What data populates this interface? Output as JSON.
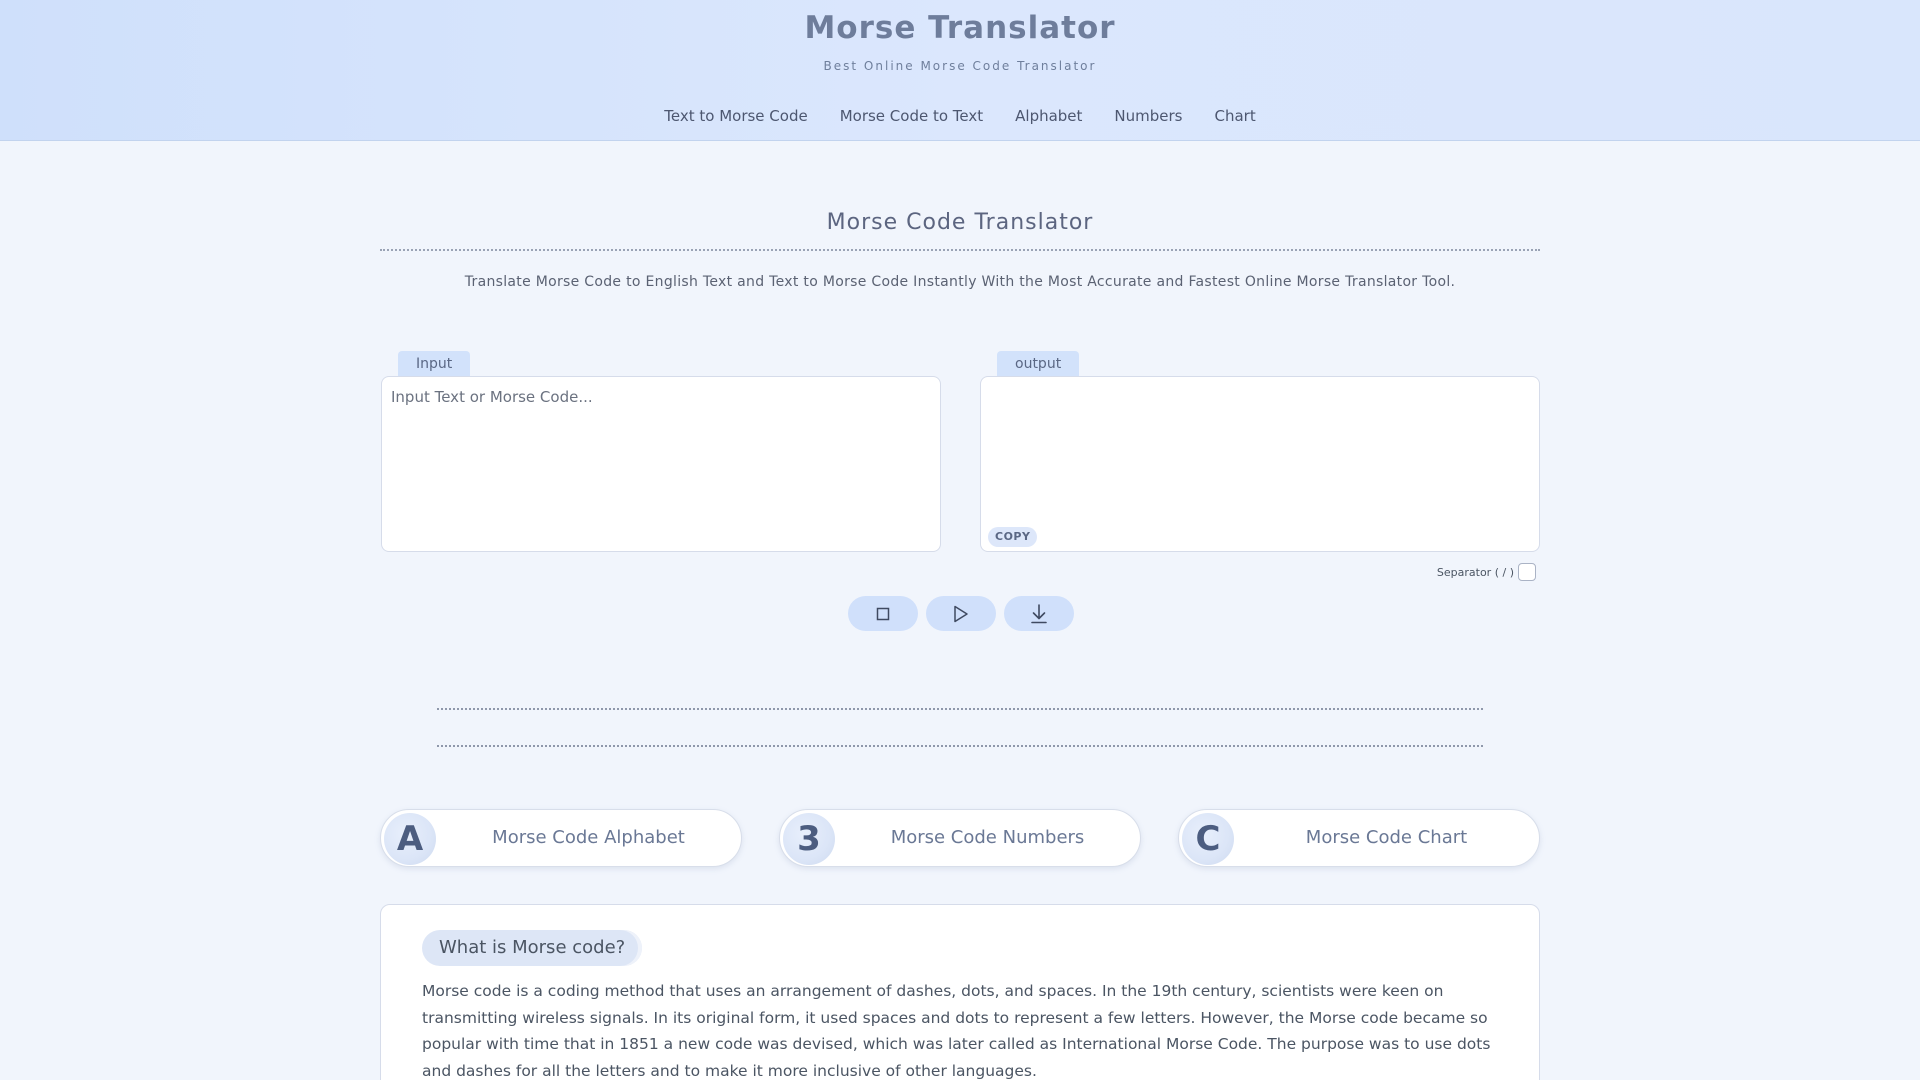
{
  "header": {
    "title": "Morse Translator",
    "subtitle": "Best Online Morse Code Translator",
    "nav": [
      "Text to Morse Code",
      "Morse Code to Text",
      "Alphabet",
      "Numbers",
      "Chart"
    ]
  },
  "main": {
    "title": "Morse Code Translator",
    "description": "Translate Morse Code to English Text and Text to Morse Code Instantly With the Most Accurate and Fastest Online Morse Translator Tool."
  },
  "input_panel": {
    "tab_label": "Input",
    "placeholder": "Input Text or Morse Code...",
    "value": ""
  },
  "output_panel": {
    "tab_label": "output",
    "value": "",
    "copy_label": "COPY"
  },
  "separator": {
    "label": "Separator ( / )",
    "checked": false
  },
  "controls": {
    "icons": [
      "stop-icon",
      "play-icon",
      "download-icon"
    ]
  },
  "cards": [
    {
      "badge": "A",
      "label": "Morse Code Alphabet",
      "icon": "letter-a-icon"
    },
    {
      "badge": "3",
      "label": "Morse Code Numbers",
      "icon": "number-3-icon"
    },
    {
      "badge": "C",
      "label": "Morse Code Chart",
      "icon": "chart-c-icon"
    }
  ],
  "info": {
    "heading": "What is Morse code?",
    "text": "Morse code is a coding method that uses an arrangement of dashes, dots, and spaces. In the 19th century, scientists were keen on transmitting wireless signals. In its original form, it used spaces and dots to represent a few letters. However, the Morse code became so popular with time that in 1851 a new code was devised, which was later called as International Morse Code. The purpose was to use dots and dashes for all the letters and to make it more inclusive of other languages."
  },
  "colors": {
    "header_bg": "#d4e3fc",
    "accent": "#d0e0fb",
    "page_bg": "#f1f5fc",
    "title_text": "#6e7d9b"
  }
}
